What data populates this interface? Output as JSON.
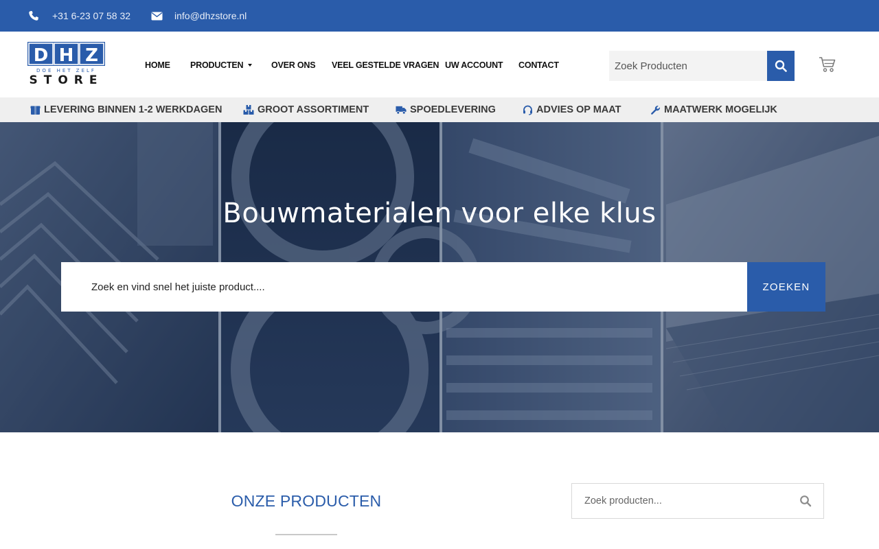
{
  "topbar": {
    "phone": "+31 6-23 07 58 32",
    "email": "info@dhzstore.nl",
    "phone_icon": "phone-icon",
    "email_icon": "envelope-icon"
  },
  "logo": {
    "top": "DHZ",
    "tagline": "DOE HET ZELF",
    "bottom": "STORE"
  },
  "nav": {
    "items": [
      {
        "label": "HOME"
      },
      {
        "label": "PRODUCTEN"
      },
      {
        "label": "OVER ONS"
      },
      {
        "label": "VEEL GESTELDE VRAGEN"
      },
      {
        "label": "UW ACCOUNT"
      },
      {
        "label": "CONTACT"
      }
    ]
  },
  "header_search": {
    "placeholder": "Zoek Producten",
    "button_icon": "search-icon"
  },
  "cart": {
    "icon": "cart-icon"
  },
  "usps": [
    {
      "label": "LEVERING BINNEN 1-2 WERKDAGEN",
      "icon": "box-icon"
    },
    {
      "label": "GROOT ASSORTIMENT",
      "icon": "boxes-icon"
    },
    {
      "label": "SPOEDLEVERING",
      "icon": "truck-icon"
    },
    {
      "label": "ADVIES OP MAAT",
      "icon": "headset-icon"
    },
    {
      "label": "MAATWERK MOGELIJK",
      "icon": "wrench-icon"
    }
  ],
  "hero": {
    "title": "Bouwmaterialen voor elke klus",
    "search_placeholder": "Zoek en vind snel het juiste product....",
    "search_button": "ZOEKEN"
  },
  "products": {
    "title": "ONZE PRODUCTEN",
    "search_placeholder": "Zoek producten..."
  },
  "colors": {
    "brand": "#2a5caa",
    "usp_bar": "#efefef"
  }
}
